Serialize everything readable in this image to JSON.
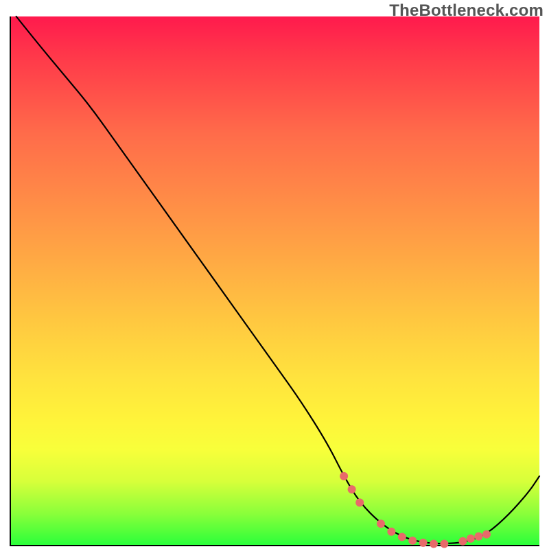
{
  "watermark": "TheBottleneck.com",
  "chart_data": {
    "type": "line",
    "title": "",
    "xlabel": "",
    "ylabel": "",
    "xlim": [
      0,
      100
    ],
    "ylim": [
      0,
      100
    ],
    "grid": false,
    "series": [
      {
        "name": "curve",
        "color": "#000000",
        "x": [
          1,
          5,
          10,
          15,
          20,
          25,
          30,
          35,
          40,
          45,
          50,
          55,
          60,
          63,
          66,
          70,
          74,
          78,
          82,
          86,
          90,
          94,
          98,
          100
        ],
        "y": [
          100,
          95,
          89,
          83,
          76,
          69,
          62,
          55,
          48,
          41,
          34,
          27,
          19,
          13,
          8,
          4,
          1.5,
          0.4,
          0.2,
          0.5,
          2,
          5.5,
          10,
          13
        ]
      }
    ],
    "markers": {
      "name": "highlight-dots",
      "color": "#e86a6a",
      "radius_px": 6,
      "x": [
        63,
        64.5,
        66,
        70,
        72,
        74,
        76,
        78,
        80,
        82,
        85.5,
        87,
        88.5,
        90
      ],
      "y": [
        13,
        10.5,
        8,
        4,
        2.5,
        1.5,
        0.8,
        0.4,
        0.2,
        0.2,
        0.7,
        1.2,
        1.6,
        2
      ]
    }
  }
}
